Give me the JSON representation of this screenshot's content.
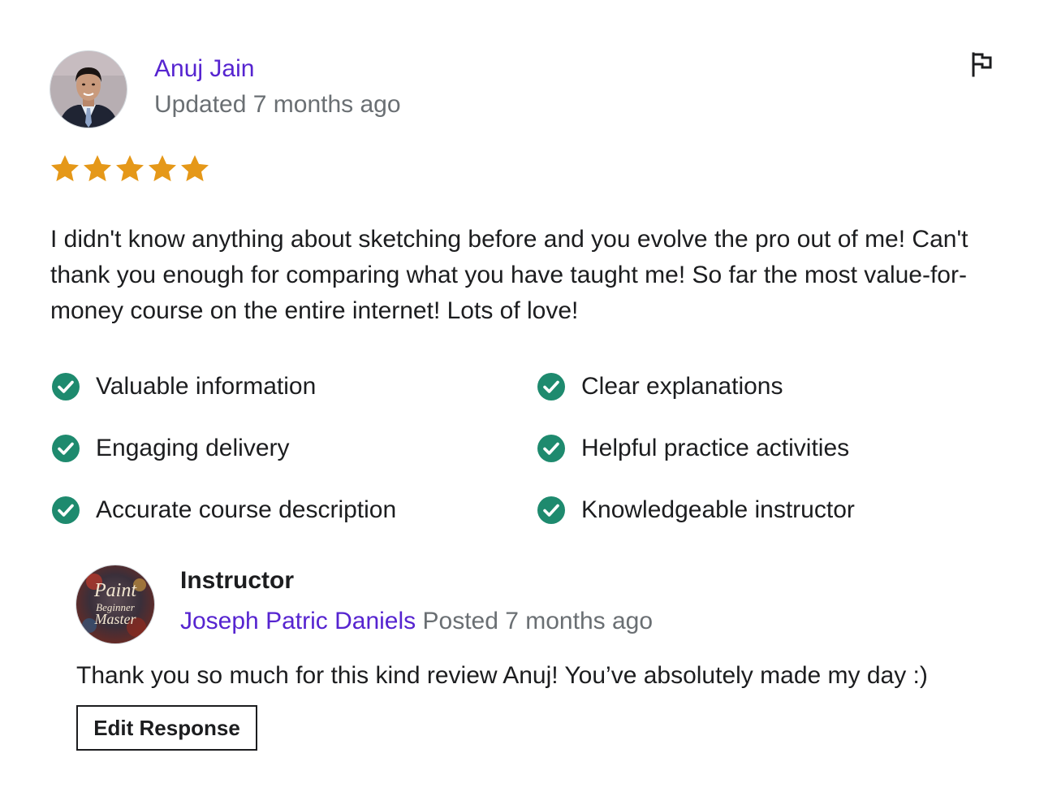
{
  "review": {
    "reviewer_name": "Anuj Jain",
    "updated": "Updated 7 months ago",
    "rating": 5,
    "max_rating": 5,
    "star_color": "#e59819",
    "text": "I didn't know anything about sketching before and you evolve the pro out of me! Can't thank you enough for comparing what you have taught me! So far the most value-for-money course on the entire internet! Lots of love!",
    "flag_icon": "flag-icon"
  },
  "feedback": {
    "check_color": "#1e8a6e",
    "items": [
      {
        "label": "Valuable information"
      },
      {
        "label": "Clear explanations"
      },
      {
        "label": "Engaging delivery"
      },
      {
        "label": "Helpful practice activities"
      },
      {
        "label": "Accurate course description"
      },
      {
        "label": "Knowledgeable instructor"
      }
    ]
  },
  "response": {
    "role": "Instructor",
    "instructor_name": "Joseph Patric Daniels",
    "posted": "Posted 7 months ago",
    "text": "Thank you so much for this kind review Anuj! You’ve absolutely made my day :)",
    "avatar_text": [
      "Paint",
      "Beginner",
      "Master"
    ],
    "edit_label": "Edit Response"
  },
  "colors": {
    "link": "#5624d0",
    "muted": "#6a6f73",
    "text": "#1c1d1f"
  }
}
